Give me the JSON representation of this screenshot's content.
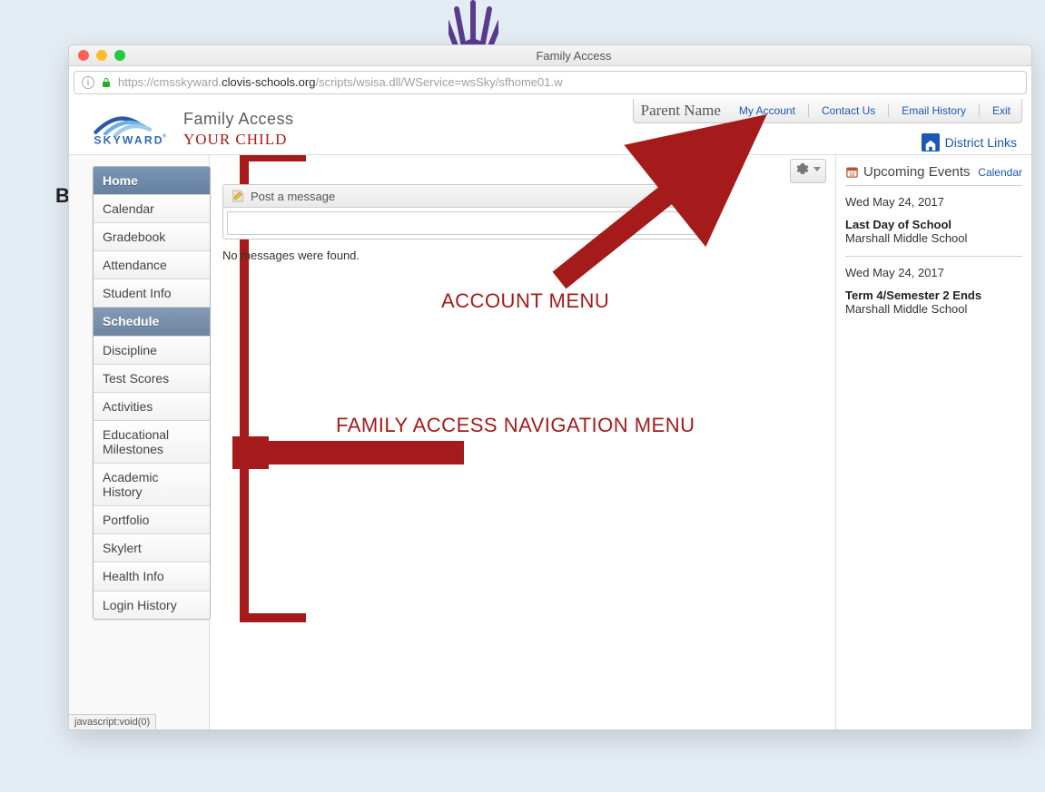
{
  "window": {
    "title": "Family Access",
    "url_pre": "https://cmsskyward.",
    "url_dark": "clovis-schools.org",
    "url_post": "/scripts/wsisa.dll/WService=wsSky/sfhome01.w",
    "statusbar": "javascript:void(0)"
  },
  "header": {
    "app_title": "Family Access",
    "child_label": "YOUR CHILD",
    "parent_name": "Parent Name",
    "links": {
      "my_account": "My Account",
      "contact": "Contact Us",
      "email_history": "Email History",
      "exit": "Exit"
    },
    "district_links": "District Links"
  },
  "nav": {
    "items": [
      "Home",
      "Calendar",
      "Gradebook",
      "Attendance",
      "Student Info",
      "Schedule",
      "Discipline",
      "Test Scores",
      "Activities",
      "Educational Milestones",
      "Academic History",
      "Portfolio",
      "Skylert",
      "Health Info",
      "Login History"
    ],
    "active_index": 0,
    "selected_index": 5
  },
  "main": {
    "post_message_label": "Post a message",
    "no_messages": "No messages were found."
  },
  "events": {
    "title": "Upcoming Events",
    "calendar_link": "Calendar",
    "items": [
      {
        "date": "Wed May 24, 2017",
        "title": "Last Day of School",
        "location": "Marshall Middle School"
      },
      {
        "date": "Wed May 24, 2017",
        "title": "Term 4/Semester 2 Ends",
        "location": "Marshall Middle School"
      }
    ]
  },
  "annotations": {
    "account": "ACCOUNT MENU",
    "nav": "FAMILY ACCESS NAVIGATION MENU"
  },
  "colors": {
    "annotation": "#A51B1B",
    "link": "#1A58B5"
  }
}
